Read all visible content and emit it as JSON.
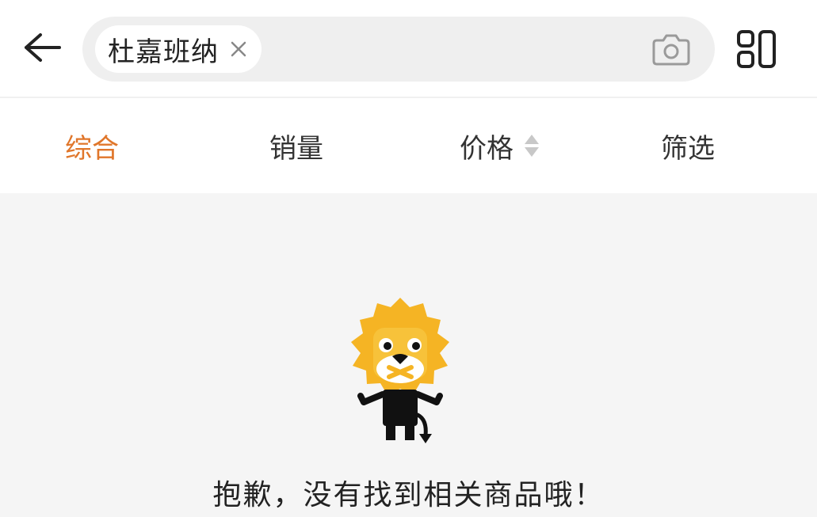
{
  "search": {
    "chip_text": "杜嘉班纳"
  },
  "sort_tabs": [
    {
      "label": "综合",
      "active": true
    },
    {
      "label": "销量",
      "active": false
    },
    {
      "label": "价格",
      "active": false
    },
    {
      "label": "筛选",
      "active": false
    }
  ],
  "empty_state": {
    "message": "抱歉，没有找到相关商品哦！"
  },
  "icons": {
    "back": "back-arrow-icon",
    "chip_close": "close-icon",
    "camera": "camera-icon",
    "layout": "layout-toggle-icon",
    "price_sort": "sort-arrows-icon",
    "mascot": "lion-mascot-icon"
  },
  "colors": {
    "accent": "#e0762a",
    "mascot_yellow": "#f5b424",
    "background": "#f5f5f5"
  }
}
